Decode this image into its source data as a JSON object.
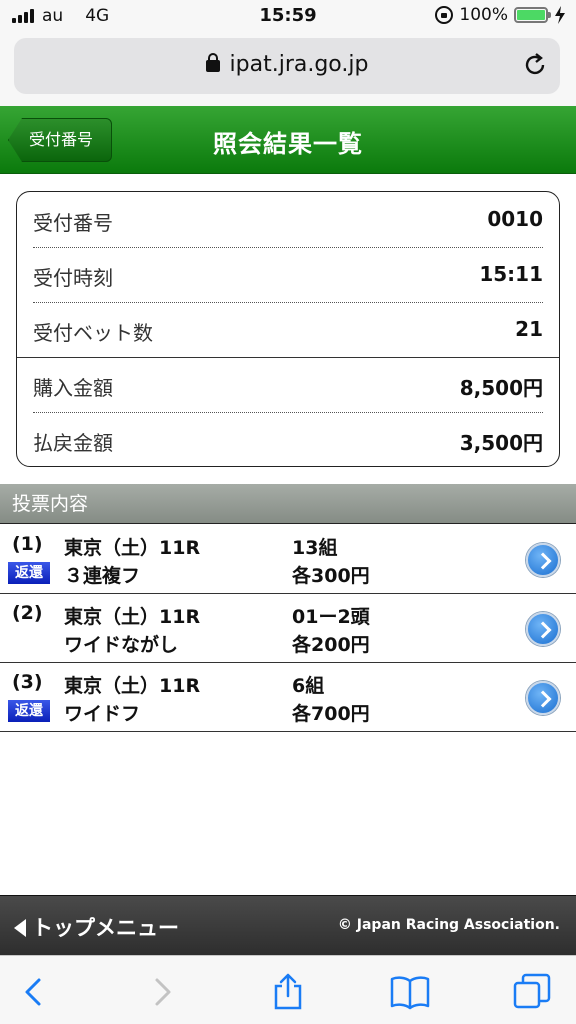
{
  "status_bar": {
    "carrier": "au",
    "network": "4G",
    "time": "15:59",
    "battery": "100%"
  },
  "browser": {
    "url": "ipat.jra.go.jp"
  },
  "header": {
    "back_label": "受付番号",
    "title": "照会結果一覧"
  },
  "receipt": {
    "rows": [
      {
        "label": "受付番号",
        "value": "0010"
      },
      {
        "label": "受付時刻",
        "value": "15:11"
      },
      {
        "label": "受付ベット数",
        "value": "21"
      },
      {
        "label": "購入金額",
        "value": "8,500円"
      },
      {
        "label": "払戻金額",
        "value": "3,500円"
      }
    ]
  },
  "bets": {
    "section_title": "投票内容",
    "items": [
      {
        "num": "(1)",
        "race": "東京（土）11R",
        "type": "３連複フ",
        "count": "13組",
        "amount": "各300円",
        "refund": "返還"
      },
      {
        "num": "(2)",
        "race": "東京（土）11R",
        "type": "ワイドながし",
        "count": "01ー2頭",
        "amount": "各200円",
        "refund": ""
      },
      {
        "num": "(3)",
        "race": "東京（土）11R",
        "type": "ワイドフ",
        "count": "6組",
        "amount": "各700円",
        "refund": "返還"
      }
    ]
  },
  "footer": {
    "menu_label": "トップメニュー",
    "copyright": "© Japan Racing Association."
  },
  "colors": {
    "header_green": "#1f8f20",
    "refund_badge": "#1a35d8",
    "detail_button": "#1a6fd1"
  }
}
